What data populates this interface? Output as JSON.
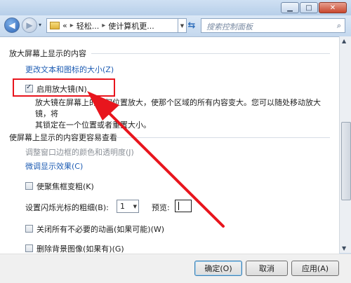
{
  "nav": {
    "history_arrow": "▾",
    "breadcrumb": [
      "«",
      "轻松...",
      "使计算机更..."
    ],
    "breadcrumb_sep": "▸",
    "search_placeholder": "搜索控制面板"
  },
  "magnifier": {
    "heading": "放大屏幕上显示的内容",
    "link_text_size": "更改文本和图标的大小(Z)",
    "enable_label": "启用放大镜(N)",
    "enable_checked": true,
    "desc_line1": "放大镜在屏幕上的任何位置放大，使那个区域的所有内容变大。您可以随处移动放大镜，将",
    "desc_line2": "其锁定在一个位置或者重置大小。"
  },
  "easier": {
    "heading": "使屏幕上显示的内容更容易查看",
    "link_window_color": "调整窗口边框的颜色和透明度(J)",
    "link_fine_tune": "微调显示效果(C)",
    "focus_label": "使聚焦框变粗(K)",
    "cursor_label": "设置闪烁光标的粗细(B):",
    "cursor_value": "1",
    "preview_label": "预览:",
    "animations_label": "关闭所有不必要的动画(如果可能)(W)",
    "background_label": "删除背景图像(如果有)(G)"
  },
  "buttons": {
    "ok": "确定(O)",
    "cancel": "取消",
    "apply": "应用(A)"
  },
  "colors": {
    "annotation": "#e8151d",
    "link": "#1e5cb3"
  }
}
